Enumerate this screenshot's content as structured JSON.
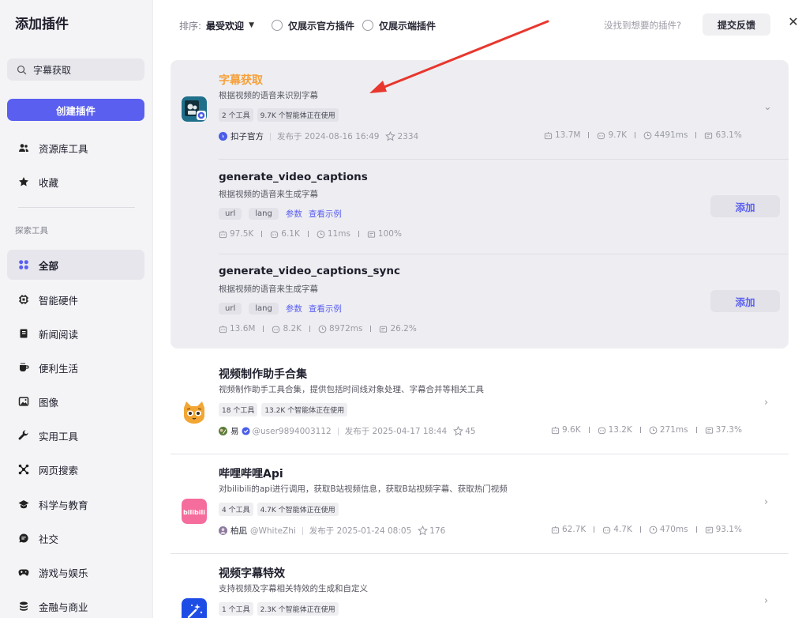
{
  "sidebar": {
    "title": "添加插件",
    "search_value": "字幕获取",
    "create_label": "创建插件",
    "top_items": [
      {
        "label": "资源库工具",
        "icon": "users-icon"
      },
      {
        "label": "收藏",
        "icon": "star-icon"
      }
    ],
    "section_label": "探索工具",
    "categories": [
      {
        "label": "全部",
        "icon": "grid-icon",
        "active": true
      },
      {
        "label": "智能硬件",
        "icon": "chip-icon"
      },
      {
        "label": "新闻阅读",
        "icon": "book-icon"
      },
      {
        "label": "便利生活",
        "icon": "cup-icon"
      },
      {
        "label": "图像",
        "icon": "image-icon"
      },
      {
        "label": "实用工具",
        "icon": "wrench-icon"
      },
      {
        "label": "网页搜索",
        "icon": "network-icon"
      },
      {
        "label": "科学与教育",
        "icon": "graduation-cap-icon"
      },
      {
        "label": "社交",
        "icon": "chat-icon"
      },
      {
        "label": "游戏与娱乐",
        "icon": "gamepad-icon"
      },
      {
        "label": "金融与商业",
        "icon": "coins-icon"
      }
    ]
  },
  "toolbar": {
    "sort_label": "排序:",
    "sort_value": "最受欢迎",
    "official_only": "仅展示官方插件",
    "client_only": "仅展示端插件",
    "not_found": "没找到想要的插件?",
    "feedback": "提交反馈"
  },
  "expanded_plugin": {
    "title": "字幕获取",
    "description": "根据视频的语音来识别字幕",
    "tags": [
      "2 个工具",
      "9.7K 个智能体正在使用"
    ],
    "author": "扣子官方",
    "published": "发布于 2024-08-16 16:49",
    "favorites": "2334",
    "stats": [
      "13.7M",
      "9.7K",
      "4491ms",
      "63.1%"
    ],
    "tools": [
      {
        "name": "generate_video_captions",
        "description": "根据视频的语音来生成字幕",
        "params": [
          "url",
          "lang"
        ],
        "param_link": "参数",
        "example_link": "查看示例",
        "add_label": "添加",
        "stats": [
          "97.5K",
          "6.1K",
          "11ms",
          "100%"
        ]
      },
      {
        "name": "generate_video_captions_sync",
        "description": "根据视频的语音来生成字幕",
        "params": [
          "url",
          "lang"
        ],
        "param_link": "参数",
        "example_link": "查看示例",
        "add_label": "添加",
        "stats": [
          "13.6M",
          "8.2K",
          "8972ms",
          "26.2%"
        ]
      }
    ]
  },
  "plugins": [
    {
      "title": "视频制作助手合集",
      "description": "视频制作助手工具合集，提供包括时间线对象处理、字幕合并等相关工具",
      "tags": [
        "18 个工具",
        "13.2K 个智能体正在使用"
      ],
      "author": "易",
      "handle": "@user9894003112",
      "published": "发布于 2025-04-17 18:44",
      "favorites": "45",
      "stats": [
        "9.6K",
        "13.2K",
        "271ms",
        "37.3%"
      ]
    },
    {
      "title": "哔哩哔哩Api",
      "description": "对bilibili的api进行调用，获取B站视频信息，获取B站视频字幕、获取热门视频",
      "tags": [
        "4 个工具",
        "4.7K 个智能体正在使用"
      ],
      "author": "柏凪",
      "handle": "@WhiteZhi",
      "published": "发布于 2025-01-24 08:05",
      "favorites": "176",
      "stats": [
        "62.7K",
        "4.7K",
        "470ms",
        "93.1%"
      ]
    },
    {
      "title": "视频字幕特效",
      "description": "支持视频及字幕相关特效的生成和自定义",
      "tags": [
        "1 个工具",
        "2.3K 个智能体正在使用"
      ]
    }
  ],
  "colors": {
    "accent": "#5a5ff0",
    "title_highlight": "#f5a03a",
    "arrow": "#e8372e"
  }
}
